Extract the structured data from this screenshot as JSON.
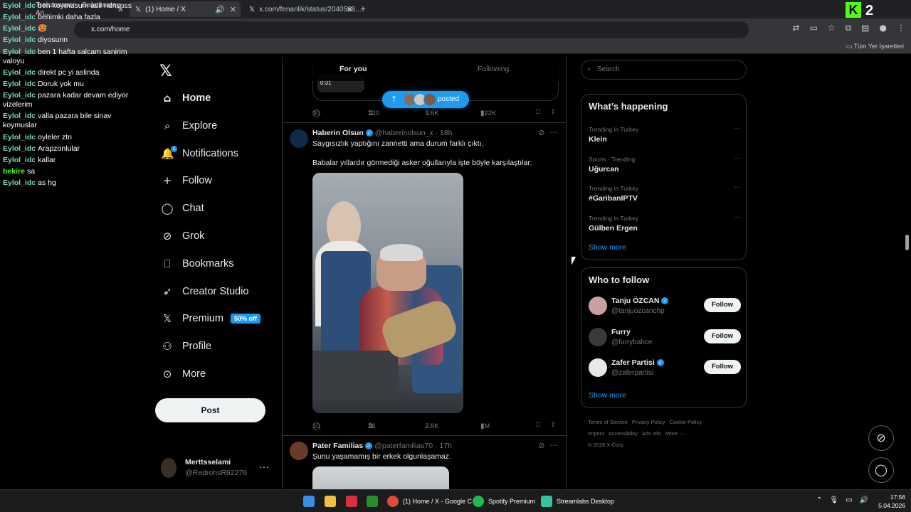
{
  "browser": {
    "tabs": [
      {
        "title": "Trabzonspor - Galatasaray An..."
      },
      {
        "title": "(1) Home / X"
      },
      {
        "title": "x.com/fenanlik/status/2040568..."
      }
    ],
    "url": "x.com/home",
    "all_bookmarks_label": "Tüm Yer İşaretleri",
    "viewer_count": "2"
  },
  "chat": [
    {
      "user": "Eylol_idc",
      "text": "ben koymusum asil ndnsnss"
    },
    {
      "user": "Eylol_idc",
      "text": "benimki daha fazla"
    },
    {
      "user": "Eylol_idc",
      "text": "🥵"
    },
    {
      "user": "Eylol_idc",
      "text": "diyosunn"
    },
    {
      "user": "Eylol_idc",
      "text": "ben 1 hafta salcam sanirim valoyu"
    },
    {
      "user": "Eylol_idc",
      "text": "direkt pc yi aslinda"
    },
    {
      "user": "Eylol_idc",
      "text": "Doruk yok mu"
    },
    {
      "user": "Eylol_idc",
      "text": "pazara kadar devam ediyor vizelerim"
    },
    {
      "user": "Eylol_idc",
      "text": "valla pazara bile sinav koymuslar"
    },
    {
      "user": "Eylol_idc",
      "text": "oyleler ztn"
    },
    {
      "user": "Eylol_idc",
      "text": "Arapzonlular"
    },
    {
      "user": "Eylol_idc",
      "text": "kallar"
    },
    {
      "user": "bekire",
      "text": "sa"
    },
    {
      "user": "Eylol_idc",
      "text": "as hg"
    }
  ],
  "nav": {
    "items": [
      {
        "label": "Home",
        "icon": "home-icon"
      },
      {
        "label": "Explore",
        "icon": "search-icon"
      },
      {
        "label": "Notifications",
        "icon": "bell-icon",
        "badge": "1"
      },
      {
        "label": "Follow",
        "icon": "add-person-icon"
      },
      {
        "label": "Chat",
        "icon": "chat-icon"
      },
      {
        "label": "Grok",
        "icon": "grok-icon"
      },
      {
        "label": "Bookmarks",
        "icon": "bookmark-icon"
      },
      {
        "label": "Creator Studio",
        "icon": "rocket-icon"
      },
      {
        "label": "Premium",
        "icon": "x-icon",
        "pill": "50% off"
      },
      {
        "label": "Profile",
        "icon": "person-icon"
      },
      {
        "label": "More",
        "icon": "more-icon"
      }
    ],
    "post_label": "Post",
    "account": {
      "name": "Merttsselami",
      "handle": "@RedrohsR62276"
    }
  },
  "timeline": {
    "tabs": [
      "For you",
      "Following"
    ],
    "posted_label": "posted",
    "prev_post": {
      "video_time": "0:31",
      "replies": "30",
      "reposts": "120",
      "likes": "3.6K",
      "views": "922K"
    },
    "tweet1": {
      "name": "Haberin Olsun",
      "handle": "@haberinolsun_x",
      "time": "18h",
      "text1": "Saygısızlık yaptığını zannetti ama durum farklı çıktı.",
      "text2": "Babalar yıllardır görmediği asker oğullarıyla işte böyle karşılaştılar:",
      "replies": "10",
      "reposts": "26",
      "likes": "2.6K",
      "views": "1M"
    },
    "tweet2": {
      "name": "Pater Familias",
      "handle": "@paterfamilias70",
      "time": "17h",
      "text": "Şunu yaşamamış bir erkek olgunlaşamaz."
    }
  },
  "right": {
    "search_placeholder": "Search",
    "whats_happening": "What’s happening",
    "trends": [
      {
        "context": "Trending in Turkey",
        "name": "Klein"
      },
      {
        "context": "Sports · Trending",
        "name": "Uğurcan"
      },
      {
        "context": "Trending in Turkey",
        "name": "#GaribanIPTV"
      },
      {
        "context": "Trending in Turkey",
        "name": "Gülben Ergen"
      }
    ],
    "show_more": "Show more",
    "who_to_follow": "Who to follow",
    "follow_suggestions": [
      {
        "name": "Tanju ÖZCAN",
        "handle": "@tanjuozcanchp",
        "verified": true
      },
      {
        "name": "Furry",
        "handle": "@furrybahce",
        "verified": false
      },
      {
        "name": "Zafer Partisi",
        "handle": "@zaferpartisi",
        "verified": true
      }
    ],
    "follow_label": "Follow",
    "footer": [
      "Terms of Service",
      "Privacy Policy",
      "Cookie Policy",
      "Imprint",
      "Accessibility",
      "Ads info",
      "More ···",
      "© 2026 X Corp."
    ]
  },
  "taskbar": {
    "items": [
      "(1) Home / X - Google C",
      "Spotify Premium",
      "Streamlabs Desktop"
    ],
    "time": "17:56",
    "date": "5.04.2026"
  },
  "colors": {
    "accent": "#1d9bf0",
    "kick_green": "#53fc18",
    "bg": "#000000"
  }
}
